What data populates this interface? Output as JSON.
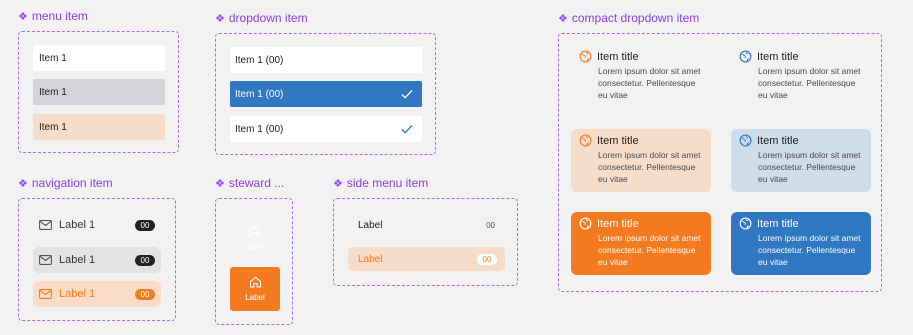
{
  "sections": {
    "menu_item": "menu item",
    "dropdown_item": "dropdown item",
    "compact_dropdown_item": "compact dropdown item",
    "navigation_item": "navigation item",
    "steward": "steward ...",
    "side_menu_item": "side menu item"
  },
  "menu_items": [
    {
      "label": "Item 1",
      "state": "default"
    },
    {
      "label": "Item 1",
      "state": "hover"
    },
    {
      "label": "Item 1",
      "state": "selected"
    }
  ],
  "dropdown_items": [
    {
      "label": "Item 1 (00)",
      "checked": false
    },
    {
      "label": "Item 1 (00)",
      "checked": true
    },
    {
      "label": "Item 1 (00)",
      "checked": true
    }
  ],
  "navigation_items": [
    {
      "label": "Label 1",
      "badge": "00",
      "icon": "mail-icon"
    },
    {
      "label": "Label 1",
      "badge": "00",
      "icon": "mail-icon"
    },
    {
      "label": "Label 1",
      "badge": "00",
      "icon": "mail-icon"
    }
  ],
  "steward_items": [
    {
      "label": "Label",
      "icon": "home-icon"
    },
    {
      "label": "Label",
      "icon": "home-icon"
    }
  ],
  "side_menu_items": [
    {
      "label": "Label",
      "badge": "00"
    },
    {
      "label": "Label",
      "badge": "00"
    }
  ],
  "compact_items": [
    {
      "title": "Item title",
      "body": "Lorem ipsum dolor sit amet consectetur. Pellentesque eu vitae",
      "icon": "globe-icon"
    },
    {
      "title": "Item title",
      "body": "Lorem ipsum dolor sit amet consectetur. Pellentesque eu vitae",
      "icon": "globe-icon"
    },
    {
      "title": "Item title",
      "body": "Lorem ipsum dolor sit amet consectetur. Pellentesque eu vitae",
      "icon": "globe-icon"
    },
    {
      "title": "Item title",
      "body": "Lorem ipsum dolor sit amet consectetur. Pellentesque eu vitae",
      "icon": "globe-icon"
    },
    {
      "title": "Item title",
      "body": "Lorem ipsum dolor sit amet consectetur. Pellentesque eu vitae",
      "icon": "globe-icon"
    },
    {
      "title": "Item title",
      "body": "Lorem ipsum dolor sit amet consectetur. Pellentesque eu vitae",
      "icon": "globe-icon"
    }
  ],
  "colors": {
    "accent_orange": "#f47b20",
    "accent_blue": "#2f77c0",
    "light_orange": "#f6ddca",
    "light_blue": "#cfdcea",
    "hover_gray": "#d3d4d8",
    "frame_purple": "#a56cf0"
  }
}
